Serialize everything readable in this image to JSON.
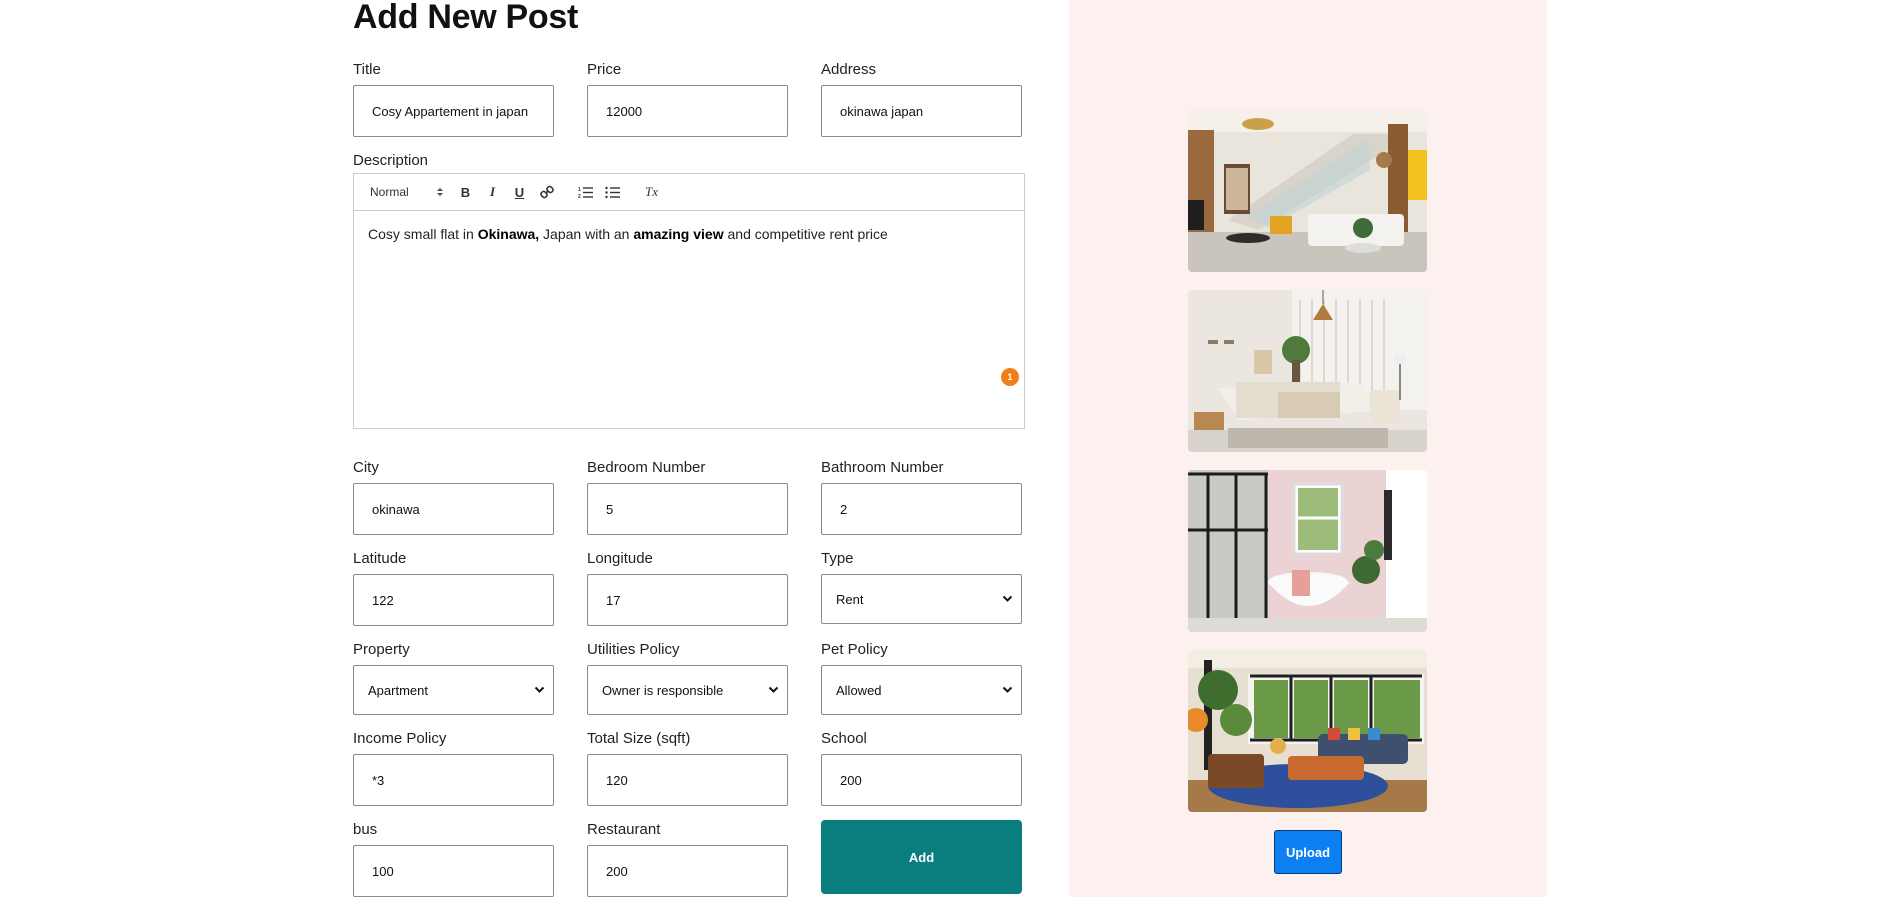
{
  "page_title": "Add New Post",
  "fields": {
    "title": {
      "label": "Title",
      "value": "Cosy Appartement in japan"
    },
    "price": {
      "label": "Price",
      "value": "12000"
    },
    "address": {
      "label": "Address",
      "value": "okinawa japan"
    },
    "city": {
      "label": "City",
      "value": "okinawa"
    },
    "bedroom": {
      "label": "Bedroom Number",
      "value": "5"
    },
    "bathroom": {
      "label": "Bathroom Number",
      "value": "2"
    },
    "latitude": {
      "label": "Latitude",
      "value": "122"
    },
    "longitude": {
      "label": "Longitude",
      "value": "17"
    },
    "type": {
      "label": "Type",
      "value": "Rent"
    },
    "property": {
      "label": "Property",
      "value": "Apartment"
    },
    "utilities": {
      "label": "Utilities Policy",
      "value": "Owner is responsible"
    },
    "pet": {
      "label": "Pet Policy",
      "value": "Allowed"
    },
    "income": {
      "label": "Income Policy",
      "value": "*3"
    },
    "size": {
      "label": "Total Size (sqft)",
      "value": "120"
    },
    "school": {
      "label": "School",
      "value": "200"
    },
    "bus": {
      "label": "bus",
      "value": "100"
    },
    "restaurant": {
      "label": "Restaurant",
      "value": "200"
    }
  },
  "description": {
    "label": "Description",
    "toolbar": {
      "format": "Normal",
      "bold": "B",
      "italic": "I",
      "underline": "U",
      "clean": "Tx"
    },
    "content": {
      "t1": "Cosy small flat in ",
      "b1": "Okinawa,",
      "t2": " Japan with an ",
      "b2": "amazing view",
      "t3": " and competitive rent price"
    },
    "badge": "1"
  },
  "buttons": {
    "add": "Add",
    "upload": "Upload"
  },
  "colors": {
    "add": "#0a7e7e",
    "upload": "#0c7ff3",
    "sidebar": "#fdf1f0",
    "badge": "#f07f1a"
  },
  "images": [
    {
      "name": "living-room-staircase"
    },
    {
      "name": "bedroom"
    },
    {
      "name": "bathroom"
    },
    {
      "name": "living-room-plants"
    }
  ]
}
